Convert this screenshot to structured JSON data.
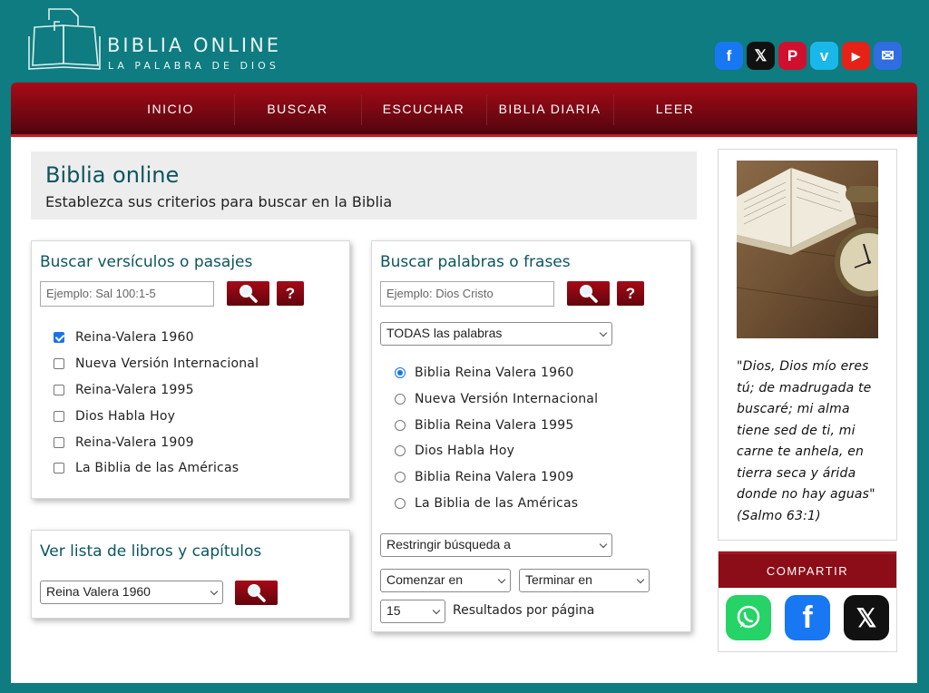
{
  "brand": {
    "title": "BIBLIA ONLINE",
    "subtitle": "LA PALABRA DE DIOS"
  },
  "social": [
    {
      "name": "facebook-icon",
      "glyph": "f",
      "color": "#1877f2"
    },
    {
      "name": "x-icon",
      "glyph": "𝕏",
      "color": "#111111"
    },
    {
      "name": "pinterest-icon",
      "glyph": "P",
      "color": "#d0102e"
    },
    {
      "name": "vimeo-icon",
      "glyph": "v",
      "color": "#1ab7ea"
    },
    {
      "name": "youtube-icon",
      "glyph": "▶",
      "color": "#e62117"
    },
    {
      "name": "email-icon",
      "glyph": "✉",
      "color": "#2f6de0"
    }
  ],
  "nav": {
    "items": [
      "INICIO",
      "BUSCAR",
      "ESCUCHAR",
      "BIBLIA DIARIA",
      "LEER"
    ]
  },
  "intro": {
    "title": "Biblia online",
    "text": "Establezca sus criterios para buscar en la Biblia"
  },
  "passages": {
    "title": "Buscar versículos o pasajes",
    "placeholder": "Ejemplo: Sal 100:1-5",
    "help": "?",
    "versions": [
      {
        "label": "Reina-Valera 1960",
        "checked": true
      },
      {
        "label": "Nueva Versión Internacional",
        "checked": false
      },
      {
        "label": "Reina-Valera 1995",
        "checked": false
      },
      {
        "label": "Dios Habla Hoy",
        "checked": false
      },
      {
        "label": "Reina-Valera 1909",
        "checked": false
      },
      {
        "label": "La Biblia de las Américas",
        "checked": false
      }
    ]
  },
  "books": {
    "title": "Ver lista de libros y capítulos",
    "selected": "Reina Valera 1960"
  },
  "words": {
    "title": "Buscar palabras o frases",
    "placeholder": "Ejemplo: Dios Cristo",
    "help": "?",
    "mode": "TODAS las palabras",
    "versions": [
      {
        "label": "Biblia Reina Valera 1960",
        "selected": true
      },
      {
        "label": "Nueva Versión Internacional",
        "selected": false
      },
      {
        "label": "Biblia Reina Valera 1995",
        "selected": false
      },
      {
        "label": "Dios Habla Hoy",
        "selected": false
      },
      {
        "label": "Biblia Reina Valera 1909",
        "selected": false
      },
      {
        "label": "La Biblia de las Américas",
        "selected": false
      }
    ],
    "restrict": "Restringir búsqueda a",
    "start": "Comenzar en",
    "end": "Terminar en",
    "per_page": "15",
    "per_page_label": "Resultados por página"
  },
  "quote": "\"Dios, Dios mío eres tú; de madrugada te buscaré; mi alma tiene sed de ti, mi carne te anhela, en tierra seca y árida donde no hay aguas\" (Salmo 63:1)",
  "share": {
    "title": "COMPARTIR",
    "icons": [
      {
        "name": "whatsapp-icon",
        "color": "#25d366"
      },
      {
        "name": "facebook-icon",
        "color": "#1877f2"
      },
      {
        "name": "x-icon",
        "color": "#111111"
      }
    ]
  }
}
